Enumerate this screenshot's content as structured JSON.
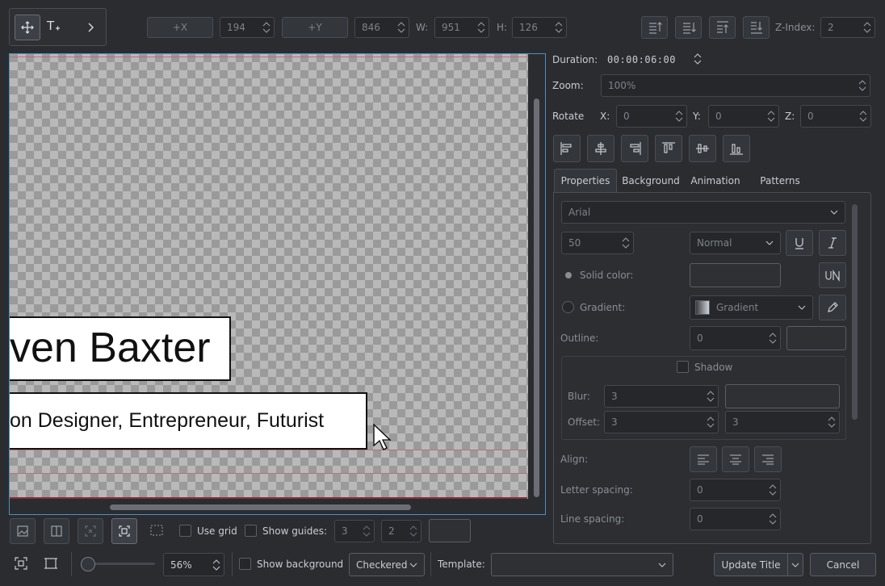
{
  "toolbar": {
    "plus_x_label": "+X",
    "x_value": "194",
    "plus_y_label": "+Y",
    "y_value": "846",
    "w_label": "W:",
    "w_value": "951",
    "h_label": "H:",
    "h_value": "126",
    "zindex_label": "Z-Index:",
    "zindex_value": "2"
  },
  "canvas": {
    "title_text": "ven Baxter",
    "subtitle_text": "on Designer, Entrepreneur, Futurist"
  },
  "right_panel": {
    "duration_label": "Duration:",
    "duration_value": "00:00:06:00",
    "zoom_label": "Zoom:",
    "zoom_value": "100%",
    "rotate_label": "Rotate",
    "rx_label": "X:",
    "rx_value": "0",
    "ry_label": "Y:",
    "ry_value": "0",
    "rz_label": "Z:",
    "rz_value": "0",
    "tabs": [
      {
        "label": "Properties",
        "active": true
      },
      {
        "label": "Background",
        "active": false
      },
      {
        "label": "Animation",
        "active": false
      },
      {
        "label": "Patterns",
        "active": false
      }
    ],
    "properties": {
      "font_family": "Arial",
      "font_size": "50",
      "font_weight": "Normal",
      "solid_color_label": "Solid color:",
      "gradient_label": "Gradient:",
      "gradient_value": "Gradient",
      "outline_label": "Outline:",
      "outline_value": "0",
      "shadow_label": "Shadow",
      "blur_label": "Blur:",
      "blur_value": "3",
      "offset_label": "Offset:",
      "offset_x_value": "3",
      "offset_y_value": "3",
      "align_label": "Align:",
      "letter_spacing_label": "Letter spacing:",
      "letter_spacing_value": "0",
      "line_spacing_label": "Line spacing:",
      "line_spacing_value": "0"
    }
  },
  "bottom_tools": {
    "use_grid_label": "Use grid",
    "show_guides_label": "Show guides:",
    "guides_h_value": "3",
    "guides_v_value": "2"
  },
  "status_bar": {
    "zoom_percent": "56%",
    "show_background_label": "Show background",
    "background_mode": "Checkered",
    "template_label": "Template:",
    "template_value": "",
    "update_title_label": "Update Title",
    "cancel_label": "Cancel"
  },
  "colors": {
    "accent": "#4a90c4",
    "window_bg": "#2a2c30",
    "guide": "#c0606a"
  },
  "icons": [
    "move-icon",
    "text-tool-icon",
    "chevron-right-icon",
    "align-left-icon",
    "align-hcenter-icon",
    "align-right-icon",
    "align-top-icon",
    "align-vcenter-icon",
    "align-bottom-icon",
    "underline-icon",
    "italic-icon",
    "text-case-icon",
    "pencil-icon",
    "image-icon",
    "mirror-icon",
    "select-icon",
    "crop-icon",
    "fit-icon",
    "resize-icon"
  ]
}
